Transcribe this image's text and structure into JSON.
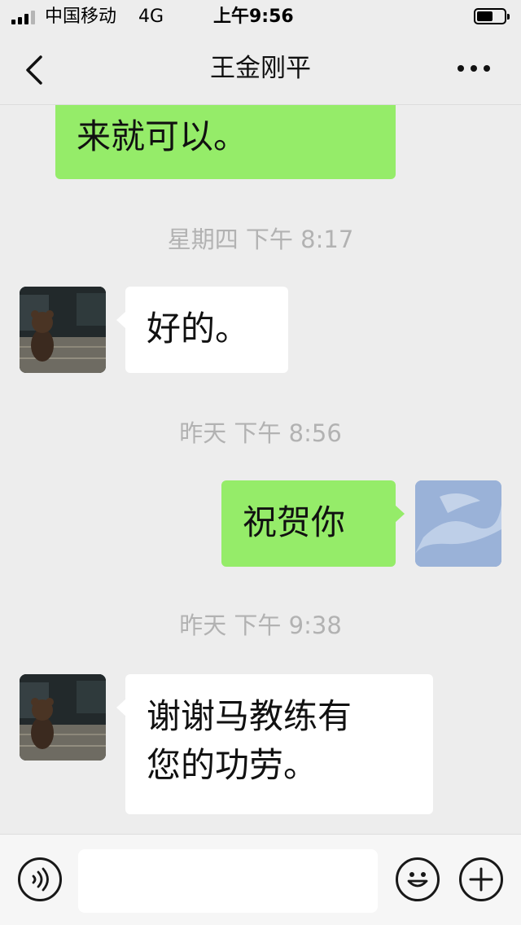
{
  "status_bar": {
    "carrier": "中国移动",
    "network": "4G",
    "time": "上午9:56",
    "battery_level": 0.6
  },
  "nav": {
    "title": "王金刚平",
    "back_icon": "chevron-left-icon",
    "more_icon": "more-dots-icon"
  },
  "messages": {
    "m0_text": "来就可以。",
    "ts1": "星期四 下午 8:17",
    "m1_text": "好的。",
    "ts2": "昨天 下午 8:56",
    "m2_text": "祝贺你",
    "ts3": "昨天 下午 9:38",
    "m3_line1": "谢谢马教练有",
    "m3_line2": "您的功劳。"
  },
  "input_bar": {
    "voice_icon": "voice-icon",
    "input_value": "",
    "emoji_icon": "emoji-icon",
    "plus_icon": "plus-icon"
  },
  "colors": {
    "background": "#ededed",
    "outgoing_bubble": "#95ec69",
    "incoming_bubble": "#ffffff",
    "timestamp": "#b2b2b2"
  }
}
